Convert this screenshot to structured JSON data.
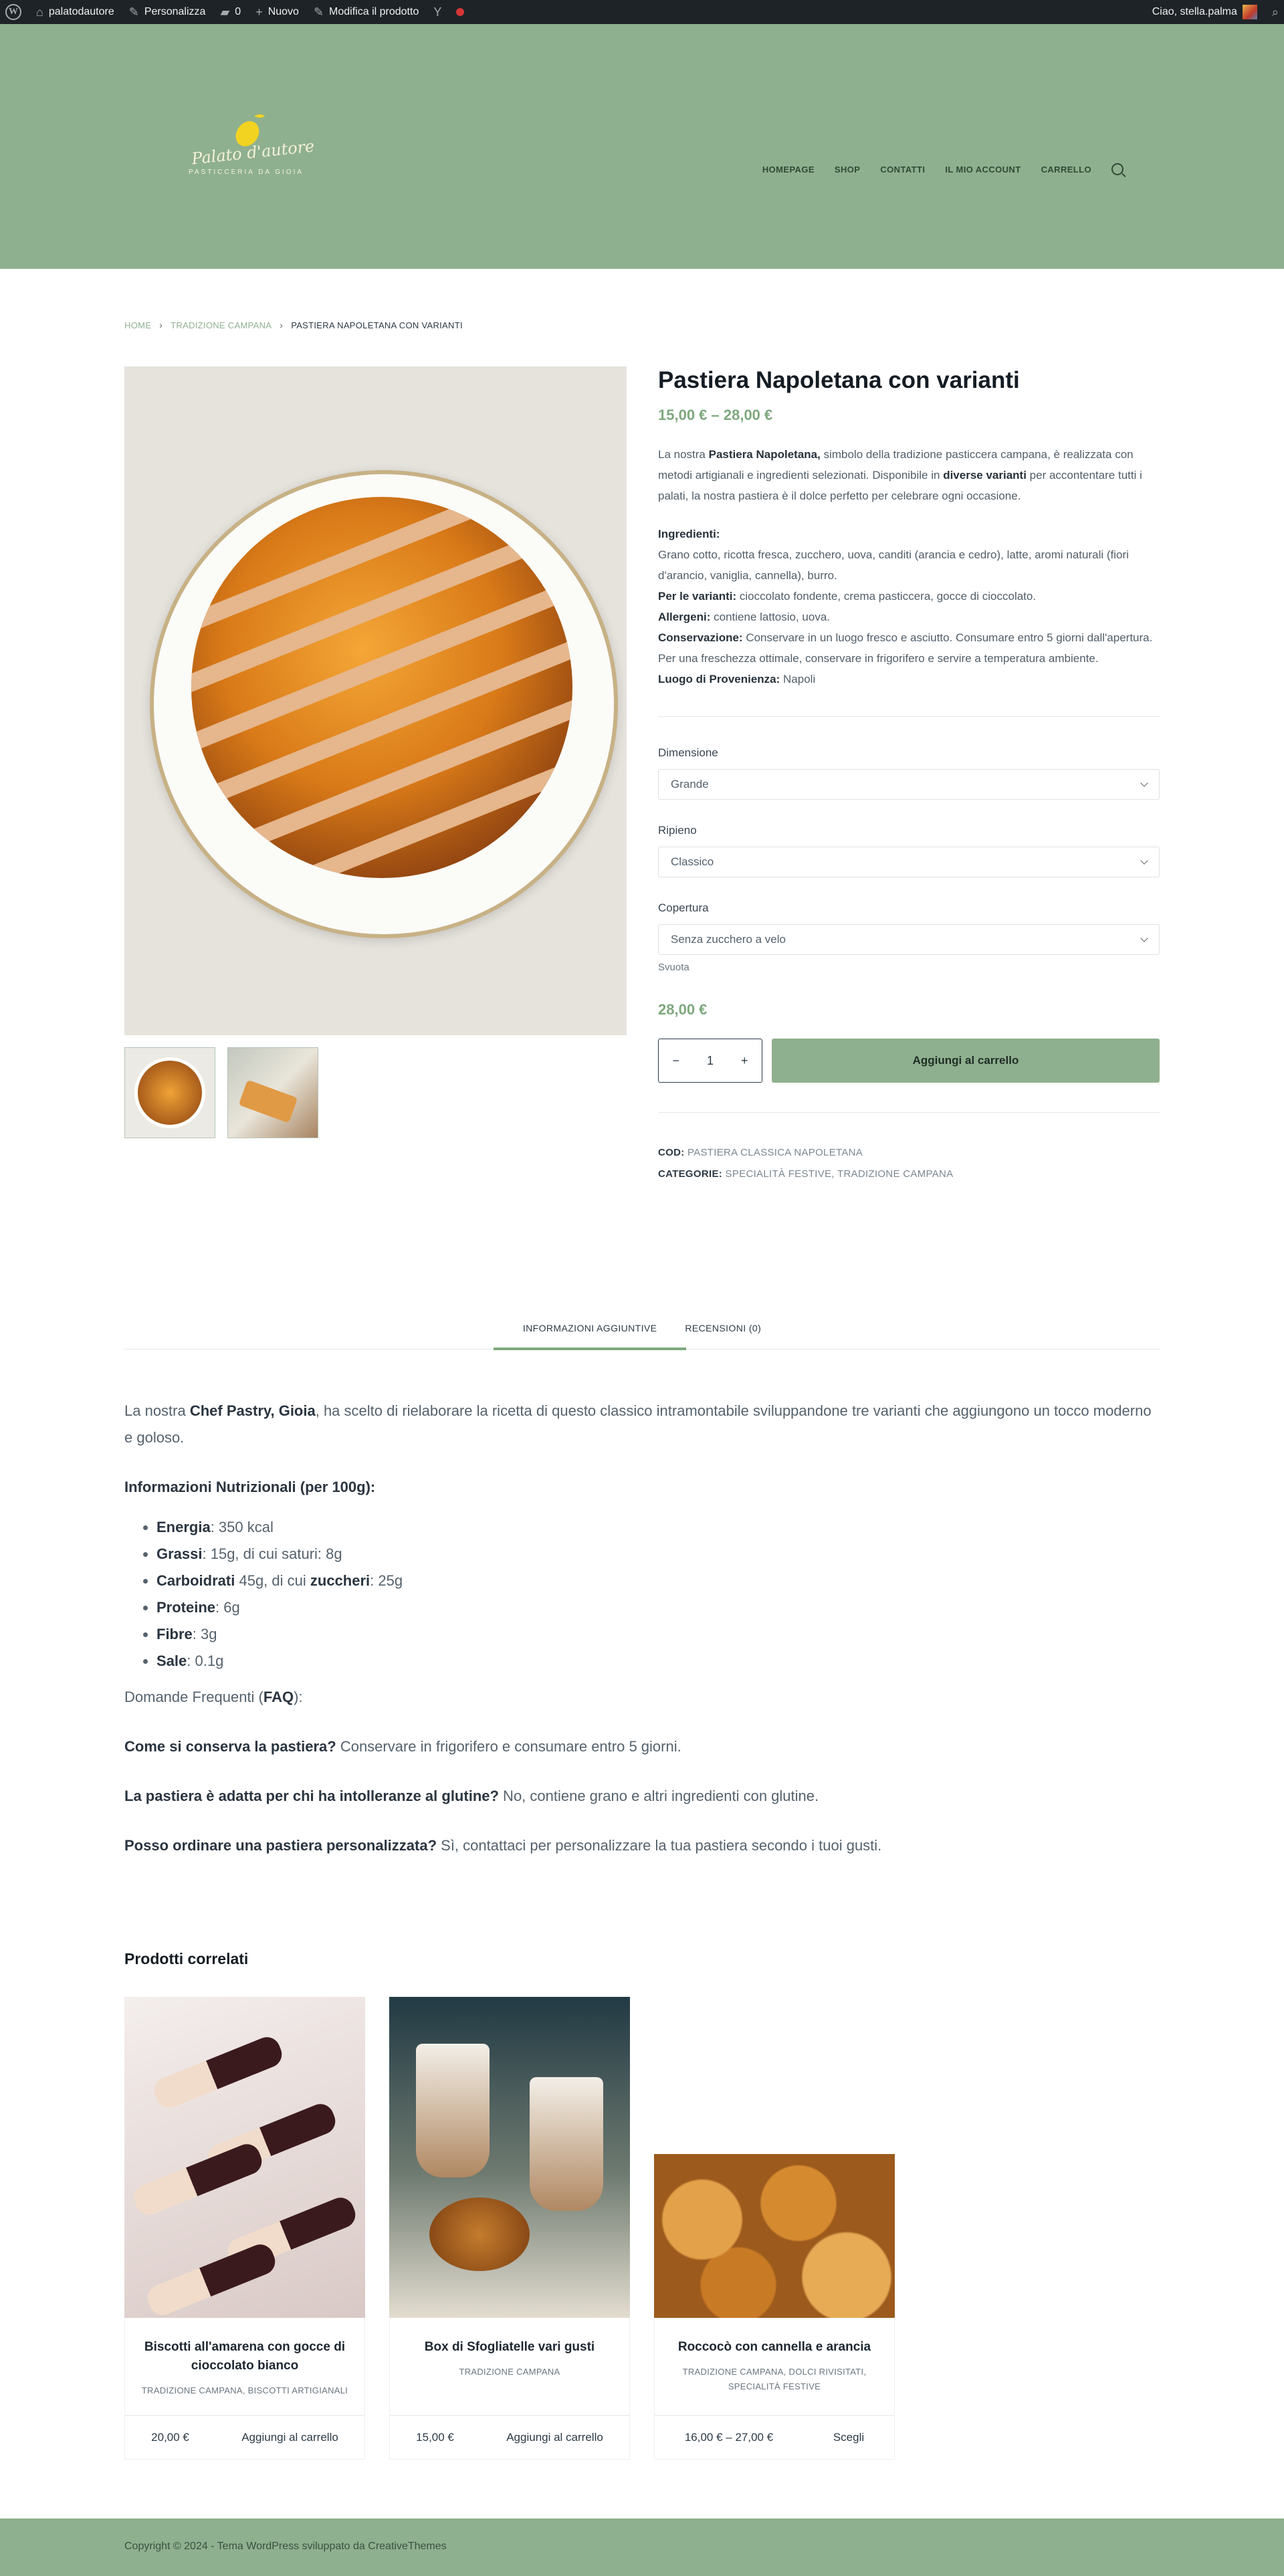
{
  "adminbar": {
    "site": "palatodautore",
    "customize": "Personalizza",
    "comments": "0",
    "new": "Nuovo",
    "edit": "Modifica il prodotto",
    "greeting": "Ciao, stella.palma"
  },
  "logo": {
    "script": "Palato d'autore",
    "subtitle": "PASTICCERIA DA GIOIA"
  },
  "nav": [
    "HOMEPAGE",
    "SHOP",
    "CONTATTI",
    "IL MIO ACCOUNT",
    "CARRELLO"
  ],
  "breadcrumb": {
    "home": "HOME",
    "category": "TRADIZIONE CAMPANA",
    "current": "PASTIERA NAPOLETANA CON VARIANTI"
  },
  "product": {
    "title": "Pastiera Napoletana con varianti",
    "price_range": "15,00 € – 28,00 €",
    "desc_1": "La nostra ",
    "desc_b1": "Pastiera Napoletana,",
    "desc_2": " simbolo della tradizione pasticcera campana, è realizzata con metodi artigianali e ingredienti selezionati. Disponibile in ",
    "desc_b2": "diverse varianti",
    "desc_3": " per accontentare tutti i palati, la nostra pastiera è il dolce perfetto per celebrare ogni occasione.",
    "ing_label": "Ingredienti:",
    "ing_text": "Grano cotto, ricotta fresca, zucchero, uova, canditi (arancia e cedro), latte, aromi naturali (fiori d'arancio, vaniglia, cannella), burro.",
    "var_label": "Per le varianti:",
    "var_text": " cioccolato fondente, crema pasticcera, gocce di cioccolato.",
    "all_label": "Allergeni:",
    "all_text": " contiene lattosio, uova.",
    "cons_label": "Conservazione:",
    "cons_text": " Conservare in un luogo fresco e asciutto. Consumare entro 5 giorni dall'apertura. Per una freschezza ottimale, conservare in frigorifero e servire a temperatura ambiente.",
    "prov_label": "Luogo di Provenienza:",
    "prov_text": " Napoli",
    "variations": [
      {
        "label": "Dimensione",
        "value": "Grande"
      },
      {
        "label": "Ripieno",
        "value": "Classico"
      },
      {
        "label": "Copertura",
        "value": "Senza zucchero a velo"
      }
    ],
    "reset": "Svuota",
    "variation_price": "28,00 €",
    "quantity": "1",
    "add_to_cart": "Aggiungi al carrello",
    "sku_label": "COD:",
    "sku": "PASTIERA CLASSICA NAPOLETANA",
    "cat_label": "CATEGORIE:",
    "cat_1": "SPECIALITÀ FESTIVE",
    "cat_sep": ", ",
    "cat_2": "TRADIZIONE CAMPANA"
  },
  "tabs": [
    "INFORMAZIONI AGGIUNTIVE",
    "RECENSIONI (0)"
  ],
  "content": {
    "intro_1": "La nostra ",
    "intro_b": "Chef Pastry, Gioia",
    "intro_2": ", ha scelto di rielaborare la ricetta di questo classico intramontabile sviluppandone tre varianti che aggiungono un tocco moderno e goloso.",
    "nutri_title": "Informazioni Nutrizionali (per 100g):",
    "nutrients": [
      {
        "label": "Energia",
        "value": ": 350 kcal"
      },
      {
        "label": "Grassi",
        "value": ": 15g, di cui saturi: 8g"
      },
      {
        "label": "Carboidrati",
        "value": " 45g, di cui "
      },
      {
        "label": "Proteine",
        "value": ": 6g"
      },
      {
        "label": "Fibre",
        "value": ": 3g"
      },
      {
        "label": "Sale",
        "value": ": 0.1g"
      }
    ],
    "carb_sugar_label": "zuccheri",
    "carb_sugar_value": ": 25g",
    "faq_pre": "Domande Frequenti (",
    "faq_b": "FAQ",
    "faq_post": "):",
    "faq": [
      {
        "q": "Come si conserva la pastiera?",
        "a": " Conservare in frigorifero e consumare entro 5 giorni."
      },
      {
        "q": "La pastiera è adatta per chi ha intolleranze al glutine?",
        "a": " No, contiene grano e altri ingredienti con glutine."
      },
      {
        "q": "Posso ordinare una pastiera personalizzata?",
        "a": " Sì, contattaci per personalizzare la tua pastiera secondo i tuoi gusti."
      }
    ]
  },
  "related": {
    "title": "Prodotti correlati",
    "items": [
      {
        "name": "Biscotti all'amarena con gocce di cioccolato bianco",
        "cats": "TRADIZIONE CAMPANA, BISCOTTI ARTIGIANALI",
        "price": "20,00 €",
        "action": "Aggiungi al carrello"
      },
      {
        "name": "Box di Sfogliatelle vari gusti",
        "cats": "TRADIZIONE CAMPANA",
        "price": "15,00 €",
        "action": "Aggiungi al carrello"
      },
      {
        "name": "Roccocò con cannella e arancia",
        "cats": "TRADIZIONE CAMPANA, DOLCI RIVISITATI, SPECIALITÀ FESTIVE",
        "price": "16,00 € – 27,00 €",
        "action": "Scegli"
      }
    ]
  },
  "footer": {
    "text": "Copyright © 2024 - Tema WordPress sviluppato da CreativeThemes"
  },
  "colors": {
    "brand": "#8fb08f",
    "price": "#7ea87e",
    "adminbar": "#1d2327"
  }
}
